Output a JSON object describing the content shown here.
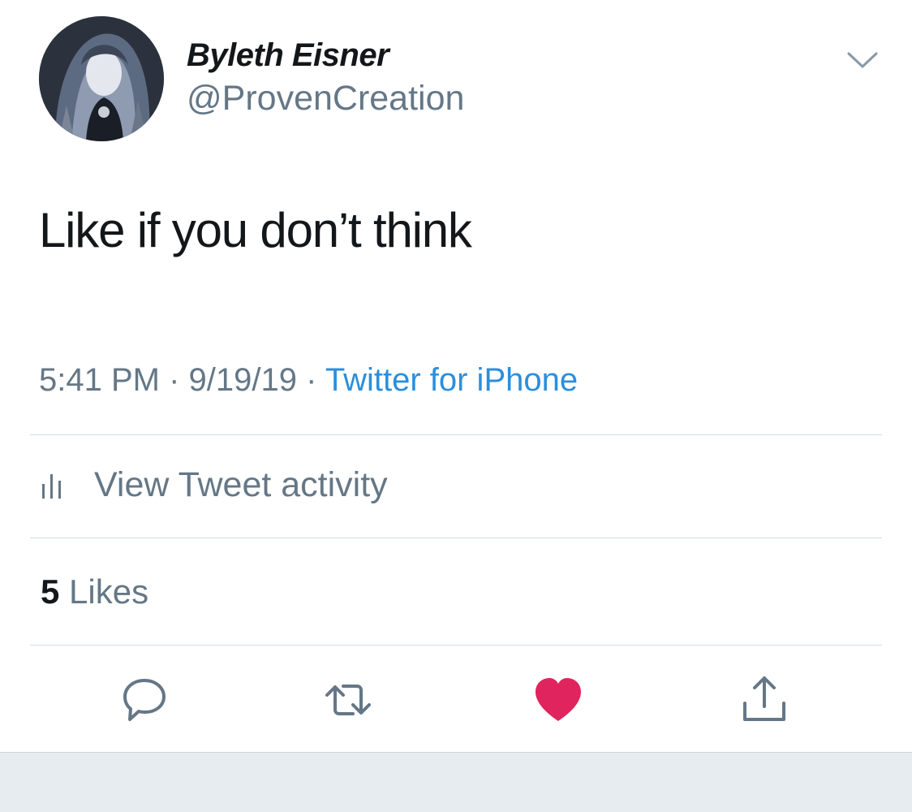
{
  "author": {
    "display_name": "Byleth Eisner",
    "handle": "@ProvenCreation",
    "avatar_icon": "profile-avatar"
  },
  "tweet": {
    "text": "Like if you don’t think",
    "time": "5:41 PM",
    "date": "9/19/19",
    "separator": "·",
    "source": "Twitter for iPhone"
  },
  "activity": {
    "label": "View Tweet activity",
    "icon": "bar-chart-icon"
  },
  "likes": {
    "count": "5",
    "label": "Likes"
  },
  "actions": {
    "reply_icon": "reply-icon",
    "retweet_icon": "retweet-icon",
    "like_icon": "heart-icon",
    "share_icon": "share-icon",
    "liked": true
  },
  "colors": {
    "like": "#e0245e",
    "link": "#2b8fdc",
    "secondary_text": "#657786",
    "primary_text": "#14171a"
  }
}
